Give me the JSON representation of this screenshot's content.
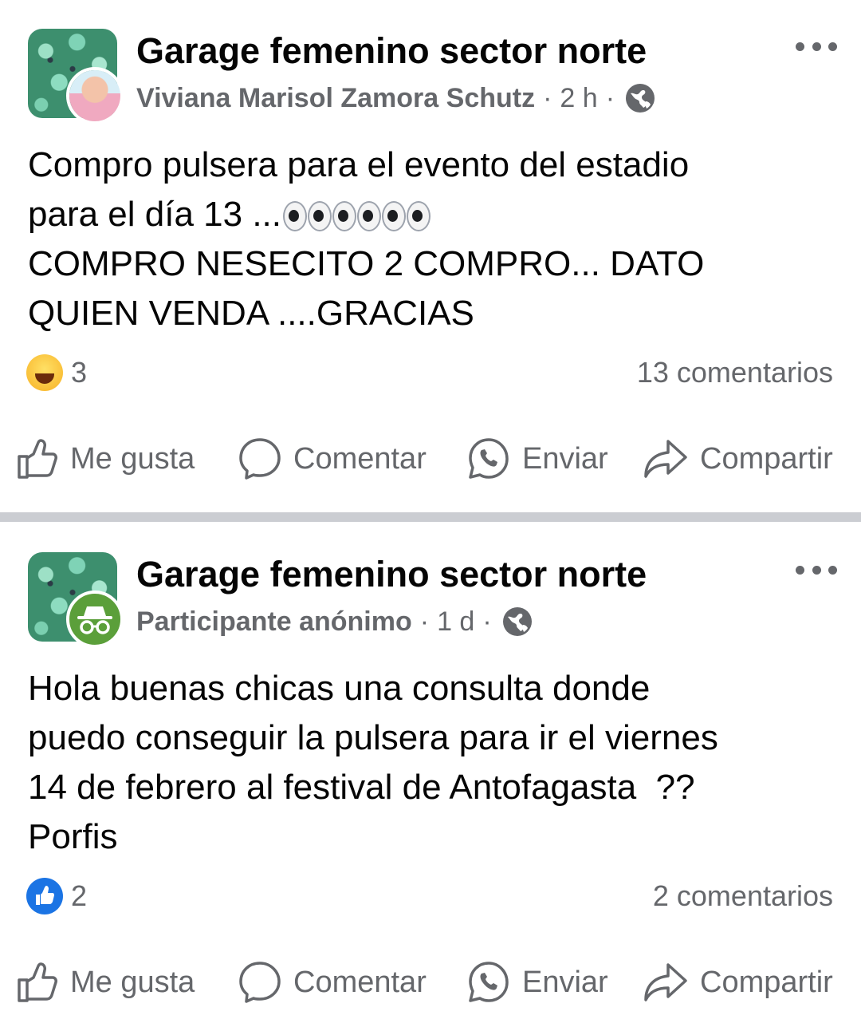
{
  "posts": [
    {
      "group_name": "Garage femenino sector norte",
      "author": "Viviana Marisol Zamora Schutz",
      "time": "2 h",
      "body_lines": [
        "Compro pulsera para el evento del estadio",
        "para el día 13 ...",
        "COMPRO NESECITO 2 COMPRO... DATO",
        "QUIEN VENDA ....GRACIAS"
      ],
      "emoji": "eyes-emoji x6",
      "reaction_type": "haha",
      "reaction_count": "3",
      "comments": "13 comentarios"
    },
    {
      "group_name": "Garage femenino sector norte",
      "author": "Participante anónimo",
      "time": "1 d",
      "body_lines": [
        "Hola buenas chicas una consulta donde",
        "puedo conseguir la pulsera para ir el viernes",
        "14 de febrero al festival de Antofagasta  ??",
        "Porfis"
      ],
      "reaction_type": "like",
      "reaction_count": "2",
      "comments": "2 comentarios"
    }
  ],
  "actions": {
    "like": "Me gusta",
    "comment": "Comentar",
    "send": "Enviar",
    "share": "Compartir"
  },
  "separator": "·",
  "colors": {
    "text": "#050505",
    "secondary": "#65676b",
    "separator": "#cbcdd2",
    "like_blue": "#1b74e4",
    "anon_green": "#5b9f3a"
  }
}
